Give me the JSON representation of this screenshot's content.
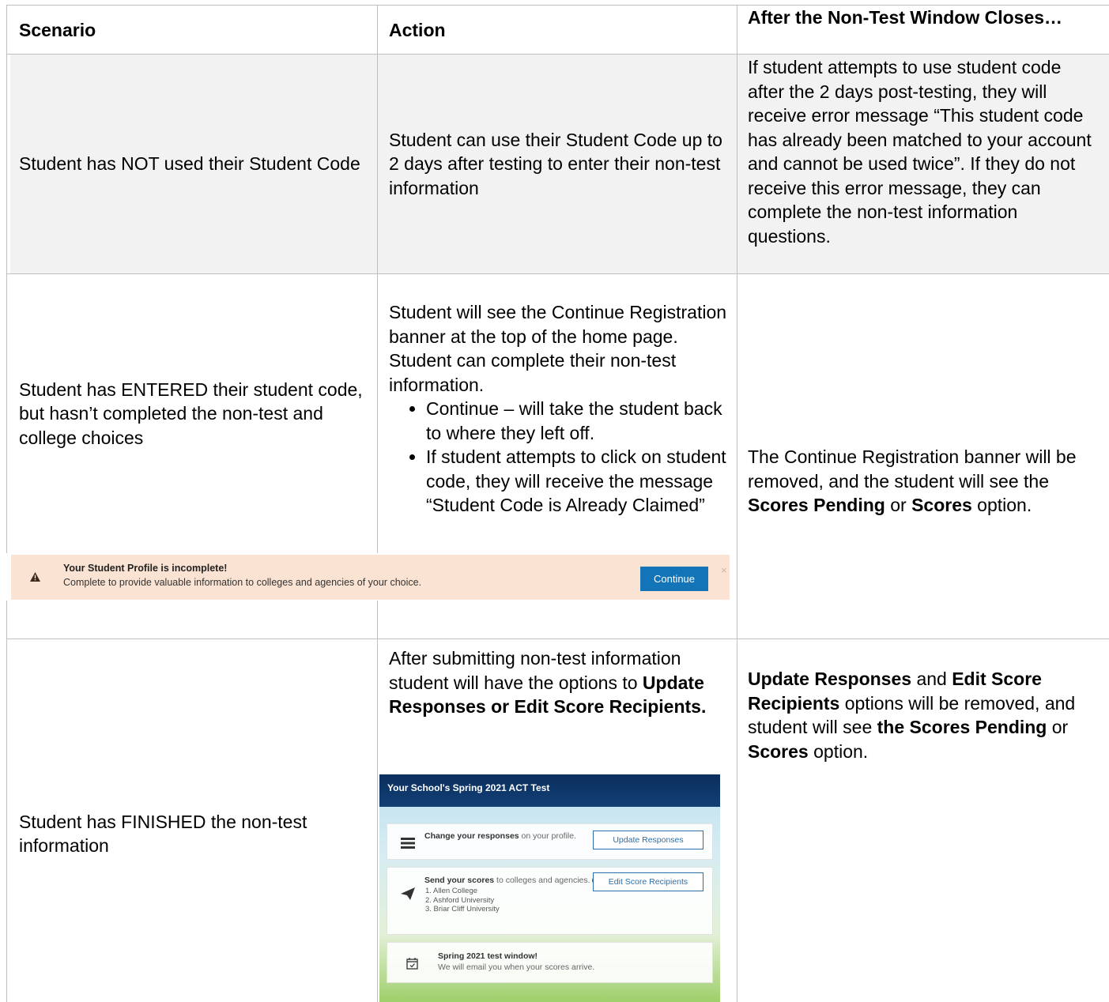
{
  "table": {
    "headers": [
      "Scenario",
      "Action",
      "After the Non-Test Window Closes…"
    ],
    "row1": {
      "scenario": "Student has NOT used their Student Code",
      "action": "Student can use their Student Code up to 2 days after testing to enter their non-test information",
      "after": "If student attempts to use student code after the 2 days post-testing, they will receive error message “This student code has already been matched to your account and cannot be used twice”.  If they do not receive this error message, they can complete the non-test information questions."
    },
    "row2": {
      "scenario": "Student has ENTERED their student code, but hasn’t completed the non-test and college choices",
      "action_intro": "Student will see the Continue Registration banner at the top of the home page. Student can complete their non-test information.",
      "action_bullets": [
        "Continue – will take the student back to where they left off.",
        "If student attempts to click on student code, they will receive the message “Student Code is Already Claimed”"
      ],
      "after_part1": "The Continue Registration banner will be removed, and the student will see the ",
      "after_bold1": "Scores Pending",
      "after_part2": " or ",
      "after_bold2": "Scores",
      "after_part3": " option."
    },
    "row3": {
      "scenario": "Student has FINISHED the non-test information",
      "action_part1": "After submitting non-test information student will have the options to ",
      "action_bold": "Update Responses or Edit Score Recipients.",
      "after_bold1": "Update Responses",
      "after_part1": " and ",
      "after_bold2": "Edit Score Recipients",
      "after_part2": " options will be removed, and student will see ",
      "after_bold3": "the Scores Pending",
      "after_part3": " or ",
      "after_bold4": "Scores",
      "after_part4": " option."
    }
  },
  "banner": {
    "title": "Your Student Profile is incomplete!",
    "subtitle": "Complete to provide valuable information to colleges and agencies of your choice.",
    "button": "Continue",
    "close": "×"
  },
  "act_screen": {
    "header": "Your School's Spring 2021 ACT Test",
    "card1_bold": "Change your responses",
    "card1_rest": " on your profile.",
    "card1_button": "Update Responses",
    "card2_bold": "Send your scores",
    "card2_rest": " to colleges and agencies.",
    "card2_button": "Edit Score Recipients",
    "colleges": [
      "1. Allen College",
      "2. Ashford University",
      "3. Briar Cliff University"
    ],
    "card3_title": "Spring 2021 test window!",
    "card3_text": "We will email you when your scores arrive."
  },
  "colors": {
    "grid": "#bfbfbf",
    "row_shade": "#f2f2f2",
    "banner_bg": "#fbe3d3",
    "button_blue": "#1474b8",
    "act_header": "#0b2f5e"
  }
}
